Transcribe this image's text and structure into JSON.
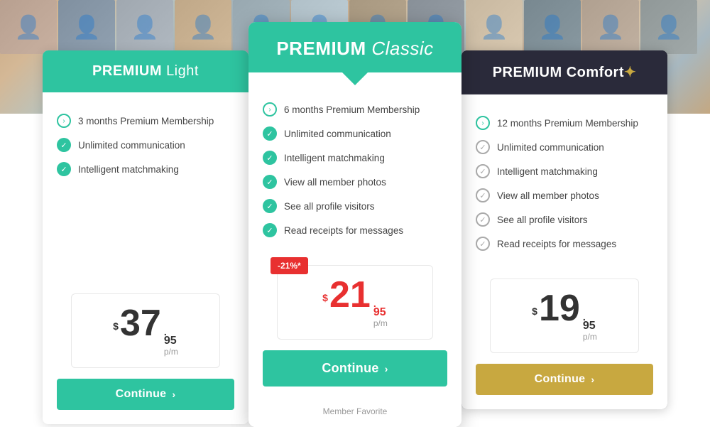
{
  "background": {
    "photos": [
      1,
      2,
      3,
      4,
      5,
      6,
      7,
      8,
      9,
      10,
      11,
      12,
      1,
      2,
      3,
      4,
      5,
      6,
      7,
      20
    ]
  },
  "plans": {
    "light": {
      "name": "PREMIUM",
      "nameStyle": "bold",
      "subtitle": "Light",
      "subtitleStyle": "light",
      "features": [
        {
          "text": "3 months Premium Membership",
          "icon": "circle-arrow"
        },
        {
          "text": "Unlimited communication",
          "icon": "check-filled"
        },
        {
          "text": "Intelligent matchmaking",
          "icon": "check-filled"
        }
      ],
      "price": {
        "currency": "$",
        "main": "37",
        "cents": "95",
        "period": "p/m"
      },
      "button": {
        "label": "Continue",
        "chevron": "›"
      }
    },
    "classic": {
      "name": "PREMIUM",
      "subtitle": "Classic",
      "features": [
        {
          "text": "6 months Premium Membership",
          "icon": "circle-arrow"
        },
        {
          "text": "Unlimited communication",
          "icon": "check-filled"
        },
        {
          "text": "Intelligent matchmaking",
          "icon": "check-filled"
        },
        {
          "text": "View all member photos",
          "icon": "check-filled"
        },
        {
          "text": "See all profile visitors",
          "icon": "check-filled"
        },
        {
          "text": "Read receipts for messages",
          "icon": "check-filled"
        }
      ],
      "discount": "-21%*",
      "price": {
        "currency": "$",
        "main": "21",
        "cents": "95",
        "period": "p/m"
      },
      "button": {
        "label": "Continue",
        "chevron": "›"
      },
      "memberFavorite": "Member Favorite"
    },
    "comfort": {
      "name": "PREMIUM",
      "subtitle": "Comfort",
      "subtitleStar": "✦",
      "features": [
        {
          "text": "12 months Premium Membership",
          "icon": "circle-arrow"
        },
        {
          "text": "Unlimited communication",
          "icon": "check-outline"
        },
        {
          "text": "Intelligent matchmaking",
          "icon": "check-outline"
        },
        {
          "text": "View all member photos",
          "icon": "check-outline"
        },
        {
          "text": "See all profile visitors",
          "icon": "check-outline"
        },
        {
          "text": "Read receipts for messages",
          "icon": "check-outline"
        }
      ],
      "price": {
        "currency": "$",
        "main": "19",
        "cents": "95",
        "period": "p/m"
      },
      "button": {
        "label": "Continue",
        "chevron": "›"
      }
    }
  },
  "colors": {
    "green": "#2ec4a0",
    "red": "#e83030",
    "gold": "#c8a840",
    "dark": "#2a2a3a"
  }
}
